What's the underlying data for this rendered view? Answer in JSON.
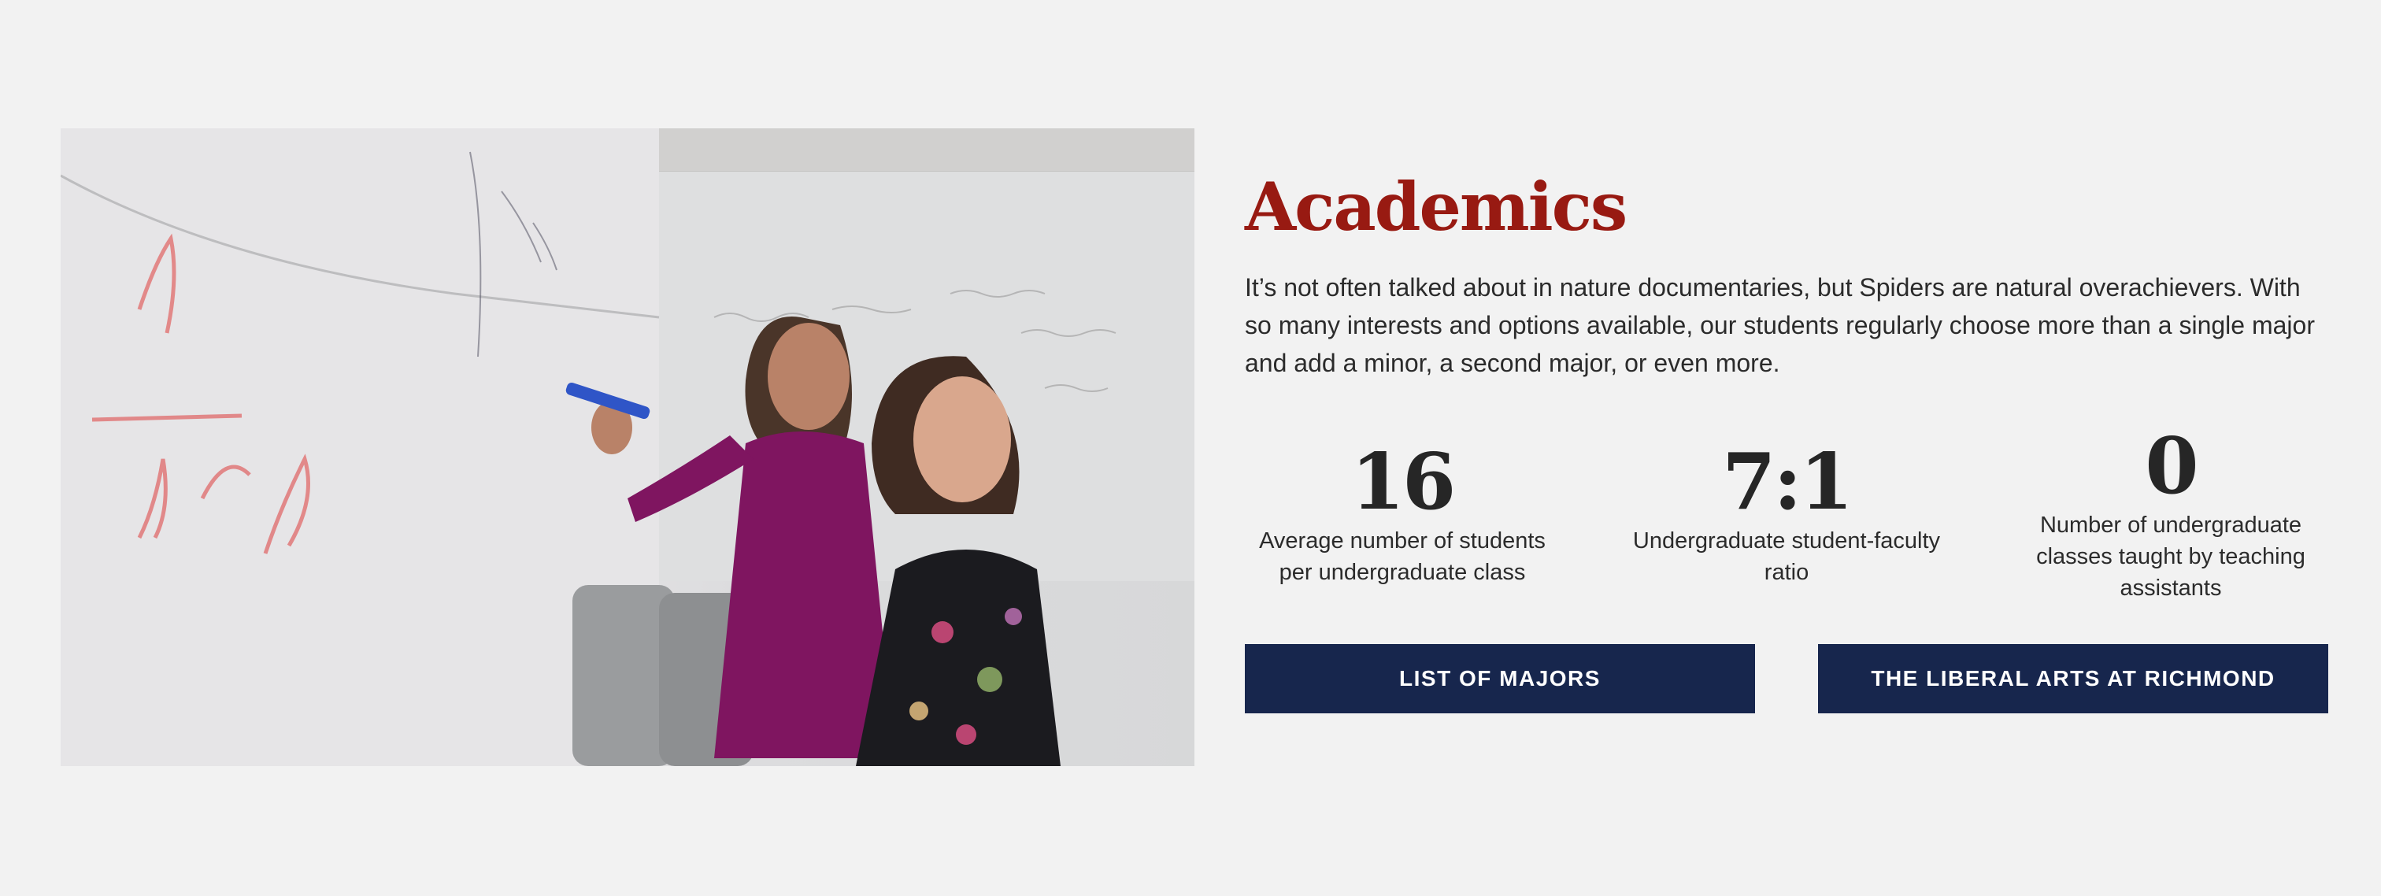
{
  "section": {
    "title": "Academics",
    "intro": "It’s not often talked about in nature documentaries, but Spiders are natural overachievers. With so many interests and options available, our students regularly choose more than a single major and add a minor, a second major, or even more."
  },
  "stats": [
    {
      "value": "16",
      "label": "Average number of students per undergraduate class"
    },
    {
      "value": "7:1",
      "label": "Undergraduate student-faculty ratio"
    },
    {
      "value": "0",
      "label": "Number of undergraduate classes taught by teaching assistants"
    }
  ],
  "buttons": {
    "majors": "LIST OF MAJORS",
    "liberal_arts": "THE LIBERAL ARTS AT RICHMOND"
  },
  "colors": {
    "background": "#f2f2f2",
    "title": "#981a12",
    "button": "#17264d",
    "button_text": "#ffffff"
  },
  "photo": {
    "icon": "photo-two-women-at-whiteboard"
  }
}
